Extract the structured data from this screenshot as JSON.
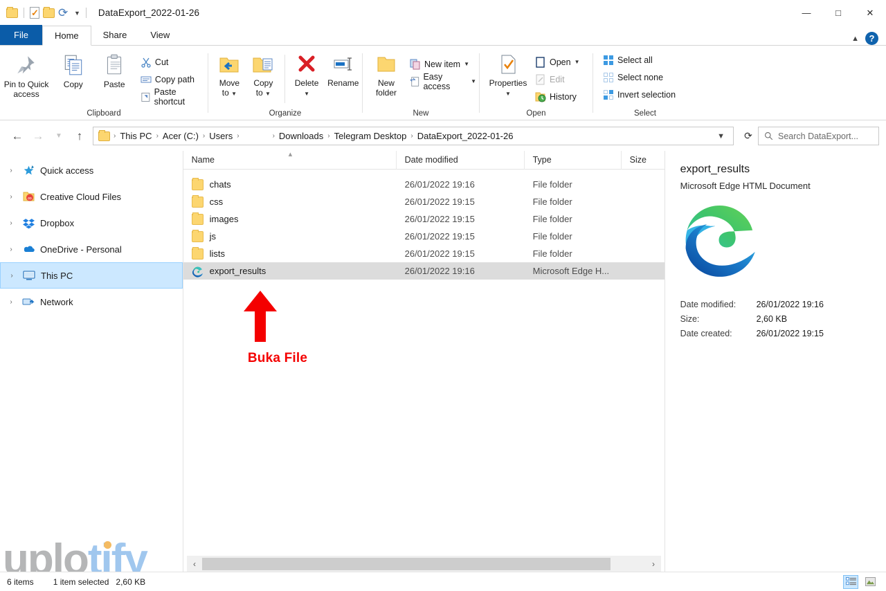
{
  "window": {
    "title": "DataExport_2022-01-26",
    "quick_access": [
      "folder-icon",
      "properties-icon",
      "new-folder-icon",
      "redo-icon",
      "chevron-down-icon"
    ],
    "controls": {
      "minimize": "─",
      "maximize": "☐",
      "close": "✕"
    }
  },
  "tabs": [
    {
      "label": "File"
    },
    {
      "label": "Home"
    },
    {
      "label": "Share"
    },
    {
      "label": "View"
    }
  ],
  "ribbon": {
    "collapse_icon": "chevron-up-icon",
    "help_icon": "help-icon",
    "help_label": "?",
    "groups": [
      {
        "label": "Clipboard",
        "big_buttons": [
          {
            "label": "Pin to Quick\naccess",
            "line1": "Pin to Quick",
            "line2": "access"
          },
          {
            "label": "Copy",
            "line1": "Copy",
            "line2": ""
          },
          {
            "label": "Paste",
            "line1": "Paste",
            "line2": ""
          }
        ],
        "small_buttons": [
          {
            "label": "Cut",
            "dim": false
          },
          {
            "label": "Copy path",
            "dim": false
          },
          {
            "label": "Paste shortcut",
            "dim": false
          }
        ]
      },
      {
        "label": "Organize",
        "big_buttons": [
          {
            "line1": "Move",
            "line2": "to",
            "caret": true
          },
          {
            "line1": "Copy",
            "line2": "to",
            "caret": true
          },
          {
            "line1": "Delete",
            "line2": "",
            "caret": true
          },
          {
            "line1": "Rename",
            "line2": "",
            "caret": false
          }
        ]
      },
      {
        "label": "New",
        "big_buttons": [
          {
            "line1": "New",
            "line2": "folder"
          }
        ],
        "small_buttons": [
          {
            "label": "New item",
            "caret": true
          },
          {
            "label": "Easy access",
            "caret": true
          }
        ]
      },
      {
        "label": "Open",
        "big_buttons": [
          {
            "line1": "Properties",
            "line2": "",
            "caret": true
          }
        ],
        "small_buttons": [
          {
            "label": "Open",
            "caret": true,
            "dim": false
          },
          {
            "label": "Edit",
            "caret": false,
            "dim": true
          },
          {
            "label": "History",
            "caret": false,
            "dim": false
          }
        ]
      },
      {
        "label": "Select",
        "small_buttons": [
          {
            "label": "Select all"
          },
          {
            "label": "Select none"
          },
          {
            "label": "Invert selection"
          }
        ]
      }
    ]
  },
  "address": {
    "back_icon": "arrow-left-icon",
    "forward_icon": "arrow-right-icon",
    "recent_icon": "chevron-down-icon",
    "up_icon": "arrow-up-icon",
    "crumbs": [
      "This PC",
      "Acer (C:)",
      "Users",
      "Downloads",
      "Telegram Desktop",
      "DataExport_2022-01-26"
    ],
    "separator": "›",
    "dropdown_icon": "chevron-down-icon",
    "refresh_icon": "refresh-icon",
    "search_placeholder": "Search DataExport...",
    "search_icon": "search-icon",
    "search_value": ""
  },
  "sidebar": {
    "items": [
      {
        "label": "Quick access",
        "icon": "star-icon",
        "selected": false
      },
      {
        "label": "Creative Cloud Files",
        "icon": "creative-cloud-icon",
        "selected": false
      },
      {
        "label": "Dropbox",
        "icon": "dropbox-icon",
        "selected": false
      },
      {
        "label": "OneDrive - Personal",
        "icon": "onedrive-icon",
        "selected": false
      },
      {
        "label": "This PC",
        "icon": "this-pc-icon",
        "selected": true
      },
      {
        "label": "Network",
        "icon": "network-icon",
        "selected": false
      }
    ],
    "expander": "›"
  },
  "filelist": {
    "columns": [
      "Name",
      "Date modified",
      "Type",
      "Size"
    ],
    "sort_indicator": "⌃",
    "rows": [
      {
        "name": "chats",
        "date": "26/01/2022 19:16",
        "type": "File folder",
        "size": "",
        "icon": "folder-icon",
        "selected": false
      },
      {
        "name": "css",
        "date": "26/01/2022 19:15",
        "type": "File folder",
        "size": "",
        "icon": "folder-icon",
        "selected": false
      },
      {
        "name": "images",
        "date": "26/01/2022 19:15",
        "type": "File folder",
        "size": "",
        "icon": "folder-icon",
        "selected": false
      },
      {
        "name": "js",
        "date": "26/01/2022 19:15",
        "type": "File folder",
        "size": "",
        "icon": "folder-icon",
        "selected": false
      },
      {
        "name": "lists",
        "date": "26/01/2022 19:15",
        "type": "File folder",
        "size": "",
        "icon": "folder-icon",
        "selected": false
      },
      {
        "name": "export_results",
        "date": "26/01/2022 19:16",
        "type": "Microsoft Edge H...",
        "size": "",
        "icon": "edge-icon",
        "selected": true
      }
    ]
  },
  "details_pane": {
    "title": "export_results",
    "subtitle": "Microsoft Edge HTML Document",
    "thumbnail_icon": "edge-icon",
    "fields": [
      {
        "key": "Date modified:",
        "value": "26/01/2022 19:16"
      },
      {
        "key": "Size:",
        "value": "2,60 KB"
      },
      {
        "key": "Date created:",
        "value": "26/01/2022 19:15"
      }
    ]
  },
  "annotation": {
    "arrow_icon": "arrow-up-icon",
    "label": "Buka File",
    "color": "#f40000"
  },
  "watermark": {
    "part1": "uplo",
    "part2": "tify"
  },
  "scrollbar": {
    "left_icon": "‹",
    "right_icon": "›"
  },
  "statusbar": {
    "item_count": "6 items",
    "selection": "1 item selected",
    "selection_size": "2,60 KB",
    "view_details_icon": "details-view-icon",
    "view_large_icon": "large-icons-view-icon"
  }
}
